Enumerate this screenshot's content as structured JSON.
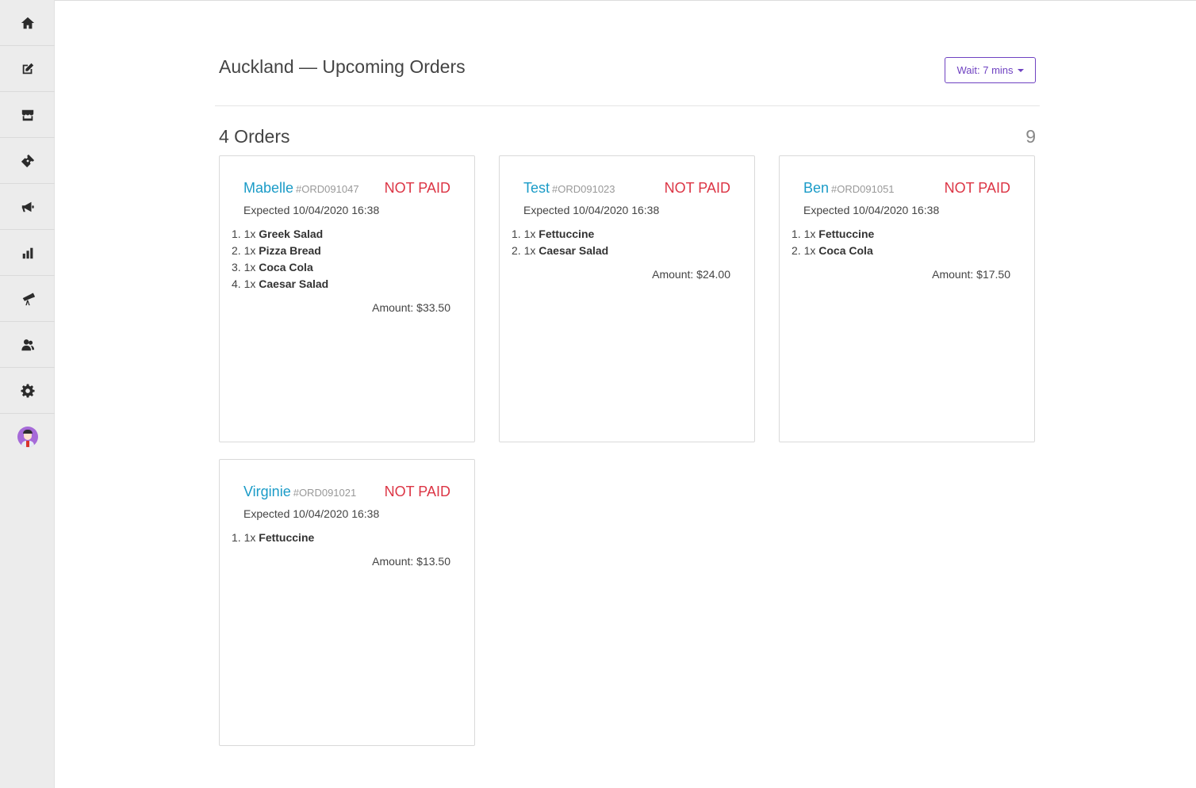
{
  "sidebar": {
    "items": [
      {
        "icon": "home-icon"
      },
      {
        "icon": "edit-icon"
      },
      {
        "icon": "store-icon"
      },
      {
        "icon": "ticket-icon"
      },
      {
        "icon": "megaphone-icon"
      },
      {
        "icon": "bar-chart-icon"
      },
      {
        "icon": "telescope-icon"
      },
      {
        "icon": "users-icon"
      },
      {
        "icon": "gear-icon"
      },
      {
        "icon": "avatar-icon"
      }
    ]
  },
  "header": {
    "title": "Auckland — Upcoming Orders",
    "wait_label": "Wait: 7 mins"
  },
  "summary": {
    "orders_count": "4 Orders",
    "right_count": "9"
  },
  "colors": {
    "customer_name": "#1a9bc7",
    "not_paid": "#dc3545",
    "accent": "#6f42c1"
  },
  "orders": [
    {
      "customer": "Mabelle",
      "order_id": "#ORD091047",
      "status": "NOT PAID",
      "expected": "Expected 10/04/2020 16:38",
      "items": [
        {
          "num": "1.",
          "qty": "1x",
          "name": "Greek Salad"
        },
        {
          "num": "2.",
          "qty": "1x",
          "name": "Pizza Bread"
        },
        {
          "num": "3.",
          "qty": "1x",
          "name": "Coca Cola"
        },
        {
          "num": "4.",
          "qty": "1x",
          "name": "Caesar Salad"
        }
      ],
      "amount": "Amount: $33.50"
    },
    {
      "customer": "Test",
      "order_id": "#ORD091023",
      "status": "NOT PAID",
      "expected": "Expected 10/04/2020 16:38",
      "items": [
        {
          "num": "1.",
          "qty": "1x",
          "name": "Fettuccine"
        },
        {
          "num": "2.",
          "qty": "1x",
          "name": "Caesar Salad"
        }
      ],
      "amount": "Amount: $24.00"
    },
    {
      "customer": "Ben",
      "order_id": "#ORD091051",
      "status": "NOT PAID",
      "expected": "Expected 10/04/2020 16:38",
      "items": [
        {
          "num": "1.",
          "qty": "1x",
          "name": "Fettuccine"
        },
        {
          "num": "2.",
          "qty": "1x",
          "name": "Coca Cola"
        }
      ],
      "amount": "Amount: $17.50"
    },
    {
      "customer": "Virginie",
      "order_id": "#ORD091021",
      "status": "NOT PAID",
      "expected": "Expected 10/04/2020 16:38",
      "items": [
        {
          "num": "1.",
          "qty": "1x",
          "name": "Fettuccine"
        }
      ],
      "amount": "Amount: $13.50"
    }
  ]
}
